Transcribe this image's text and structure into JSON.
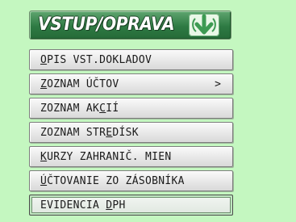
{
  "header": {
    "title": "VSTUP/OPRAVA",
    "icon": "download-arrow-icon"
  },
  "menu": {
    "items": [
      {
        "label": "OPIS VST.DOKLADOV",
        "hotkey_index": 0,
        "arrow": "",
        "active": false
      },
      {
        "label": "ZOZNAM ÚČTOV",
        "hotkey_index": 0,
        "arrow": ">",
        "active": false
      },
      {
        "label": "ZOZNAM AKCIÍ",
        "hotkey_index": 9,
        "arrow": "",
        "active": false
      },
      {
        "label": "ZOZNAM STREDÍSK",
        "hotkey_index": 10,
        "arrow": "",
        "active": false
      },
      {
        "label": "KURZY ZAHRANIČ. MIEN",
        "hotkey_index": 0,
        "arrow": "",
        "active": false
      },
      {
        "label": "ÚČTOVANIE ZO ZÁSOBNÍKA",
        "hotkey_index": 0,
        "arrow": "",
        "active": false
      },
      {
        "label": "EVIDENCIA DPH",
        "hotkey_index": 10,
        "arrow": "",
        "active": true
      }
    ]
  },
  "colors": {
    "background": "#c4f7c0",
    "header": "#2e7a43",
    "button": "#e6e6e6"
  }
}
